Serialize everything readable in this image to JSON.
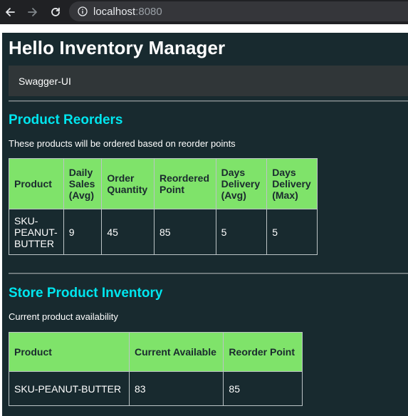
{
  "browser": {
    "url_host": "localhost",
    "url_port": ":8080"
  },
  "page": {
    "title": "Hello Inventory Manager",
    "swagger_label": "Swagger-UI"
  },
  "reorders": {
    "heading": "Product Reorders",
    "description": "These products will be ordered based on reorder points",
    "columns": [
      "Product",
      "Daily Sales (Avg)",
      "Order Quantity",
      "Reordered Point",
      "Days Delivery (Avg)",
      "Days Delivery (Max)"
    ],
    "rows": [
      [
        "SKU-PEANUT-BUTTER",
        "9",
        "45",
        "85",
        "5",
        "5"
      ]
    ]
  },
  "inventory": {
    "heading": "Store Product Inventory",
    "description": "Current product availability",
    "columns": [
      "Product",
      "Current Available",
      "Reorder Point"
    ],
    "rows": [
      [
        "SKU-PEANUT-BUTTER",
        "83",
        "85"
      ]
    ]
  },
  "colors": {
    "page_bg": "#182a2f",
    "heading_accent": "#00e5ee",
    "table_header_bg": "#7fe36a"
  }
}
